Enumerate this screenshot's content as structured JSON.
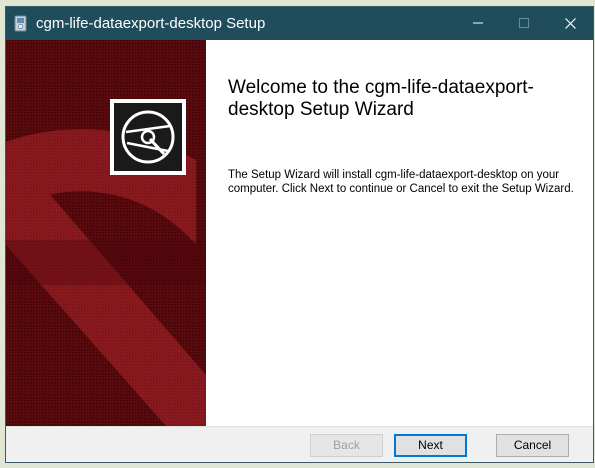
{
  "window": {
    "title": "cgm-life-dataexport-desktop Setup",
    "controls": {
      "minimize_icon": "minimize-icon",
      "maximize_icon": "maximize-icon",
      "close_icon": "close-icon"
    }
  },
  "side_panel": {
    "logo_icon": "disc-icon",
    "background_color": "#6b0a10",
    "accent_color": "#8e1a1e"
  },
  "main": {
    "title": "Welcome to the cgm-life-dataexport-desktop Setup Wizard",
    "description": "The Setup Wizard will install cgm-life-dataexport-desktop on your computer. Click Next to continue or Cancel to exit the Setup Wizard."
  },
  "buttons": {
    "back": "Back",
    "next": "Next",
    "cancel": "Cancel"
  },
  "colors": {
    "titlebar": "#1f4d5c",
    "focus_border": "#0078d7"
  }
}
